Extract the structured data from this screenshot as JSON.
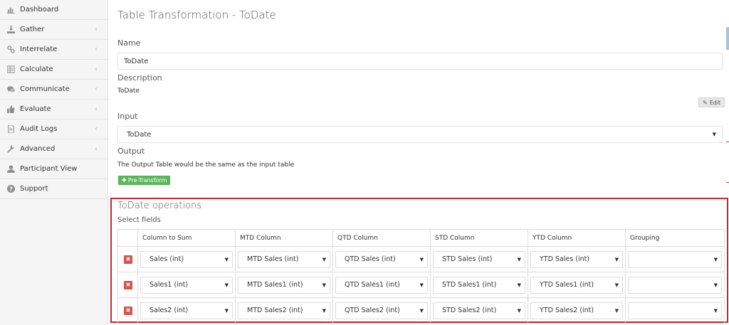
{
  "sidebar": {
    "items": [
      {
        "label": "Dashboard",
        "icon": "bar-chart-icon",
        "has_chevron": false
      },
      {
        "label": "Gather",
        "icon": "download-icon",
        "has_chevron": true
      },
      {
        "label": "Interrelate",
        "icon": "link-icon",
        "has_chevron": true
      },
      {
        "label": "Calculate",
        "icon": "table-icon",
        "has_chevron": true
      },
      {
        "label": "Communicate",
        "icon": "comments-icon",
        "has_chevron": true
      },
      {
        "label": "Evaluate",
        "icon": "thumbs-up-icon",
        "has_chevron": true
      },
      {
        "label": "Audit Logs",
        "icon": "file-icon",
        "has_chevron": true
      },
      {
        "label": "Advanced",
        "icon": "wrench-icon",
        "has_chevron": true
      },
      {
        "label": "Participant View",
        "icon": "user-icon",
        "has_chevron": false
      },
      {
        "label": "Support",
        "icon": "question-circle-icon",
        "has_chevron": false
      }
    ],
    "chevron": "‹"
  },
  "page": {
    "title": "Table Transformation - ToDate",
    "name_label": "Name",
    "name_value": "ToDate",
    "description_label": "Description",
    "description_value": "ToDate",
    "edit_label": "Edit",
    "input_label": "Input",
    "input_value": "ToDate",
    "output_label": "Output",
    "output_text": "The Output Table would be the same as the input table",
    "pre_transform_label": "Pre-Transform"
  },
  "operations": {
    "title": "ToDate operations",
    "subtitle": "Select fields",
    "columns": [
      "",
      "Column to Sum",
      "MTD Column",
      "QTD Column",
      "STD Column",
      "YTD Column",
      "Grouping"
    ],
    "rows": [
      [
        "Sales (int)",
        "MTD Sales (int)",
        "QTD Sales (int)",
        "STD Sales (int)",
        "YTD Sales (int)",
        ""
      ],
      [
        "Sales1 (int)",
        "MTD Sales1 (int)",
        "QTD Sales1 (int)",
        "STD Sales1 (int)",
        "YTD Sales1 (int)",
        ""
      ],
      [
        "Sales2 (int)",
        "MTD Sales2 (int)",
        "QTD Sales2 (int)",
        "STD Sales2 (int)",
        "YTD Sales2 (int)",
        ""
      ]
    ],
    "delete_glyph": "✖"
  },
  "colors": {
    "accent_red": "#c8262f",
    "success_green": "#5cb85c",
    "danger_red": "#d9534f"
  }
}
